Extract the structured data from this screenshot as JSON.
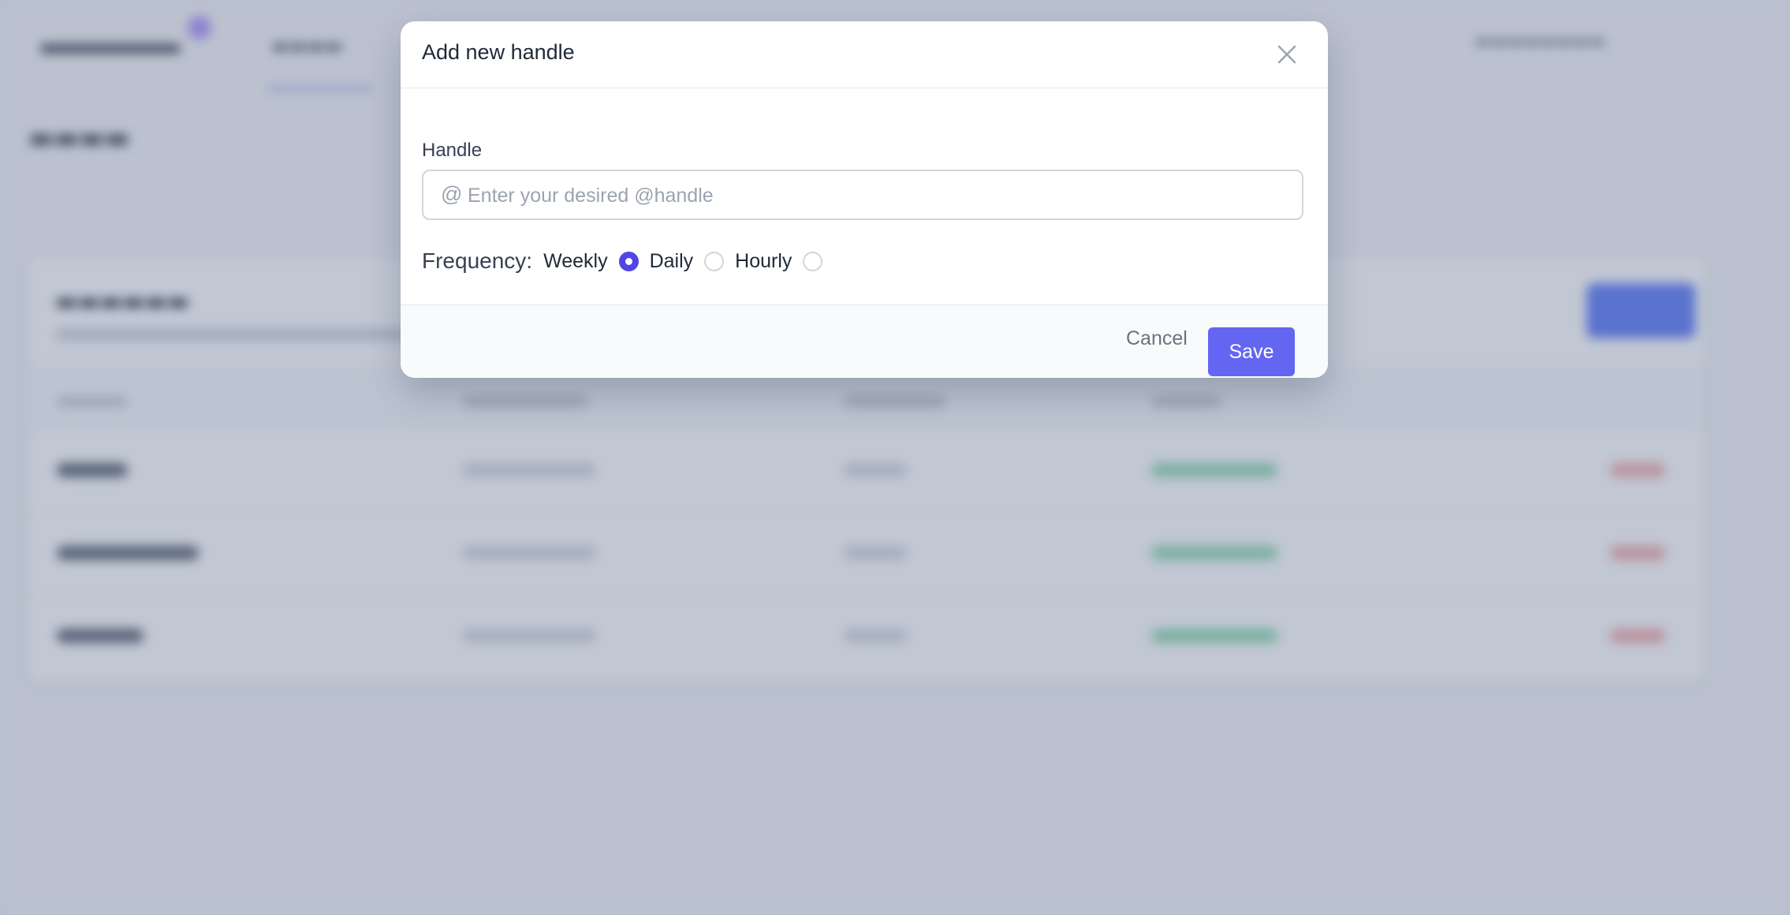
{
  "modal": {
    "title": "Add new handle",
    "handle_label": "Handle",
    "handle_prefix": "@",
    "handle_placeholder": "Enter your desired @handle",
    "handle_value": "",
    "frequency_label": "Frequency:",
    "frequency_options": [
      {
        "label": "Weekly",
        "checked": true
      },
      {
        "label": "Daily",
        "checked": false
      },
      {
        "label": "Hourly",
        "checked": false
      }
    ],
    "cancel_label": "Cancel",
    "save_label": "Save",
    "close_icon": "close-icon"
  },
  "colors": {
    "accent": "#6366f1",
    "radio_checked": "#4f46e5",
    "overlay": "#6b7996"
  }
}
